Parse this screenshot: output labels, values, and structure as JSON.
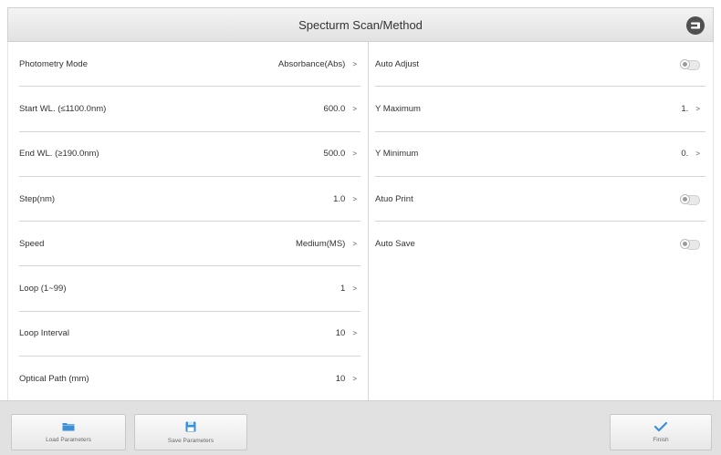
{
  "header": {
    "title": "Specturm Scan/Method"
  },
  "left_rows": [
    {
      "label": "Photometry Mode",
      "value": "Absorbance(Abs)"
    },
    {
      "label": "Start WL. (≤1100.0nm)",
      "value": "600.0"
    },
    {
      "label": "End WL. (≥190.0nm)",
      "value": "500.0"
    },
    {
      "label": "Step(nm)",
      "value": "1.0"
    },
    {
      "label": "Speed",
      "value": "Medium(MS)"
    },
    {
      "label": "Loop (1~99)",
      "value": "1"
    },
    {
      "label": "Loop Interval",
      "value": "10"
    },
    {
      "label": "Optical Path (mm)",
      "value": "10"
    }
  ],
  "right_rows": [
    {
      "label": "Auto Adjust",
      "toggle": "off"
    },
    {
      "label": "Y Maximum",
      "value": "1."
    },
    {
      "label": "Y Minimum",
      "value": "0."
    },
    {
      "label": "Atuo Print",
      "toggle": "off"
    },
    {
      "label": "Auto Save",
      "toggle": "off"
    }
  ],
  "arrow": ">",
  "footer": {
    "load_label": "Load Parameters",
    "save_label": "Save Parameters",
    "finish_label": "Finish"
  },
  "icons": {
    "back": "back-icon",
    "load": "folder-icon",
    "save": "floppy-disk-icon",
    "finish": "checkmark-icon"
  },
  "colors": {
    "accent": "#3a8fd6",
    "back_button": "#505050"
  }
}
